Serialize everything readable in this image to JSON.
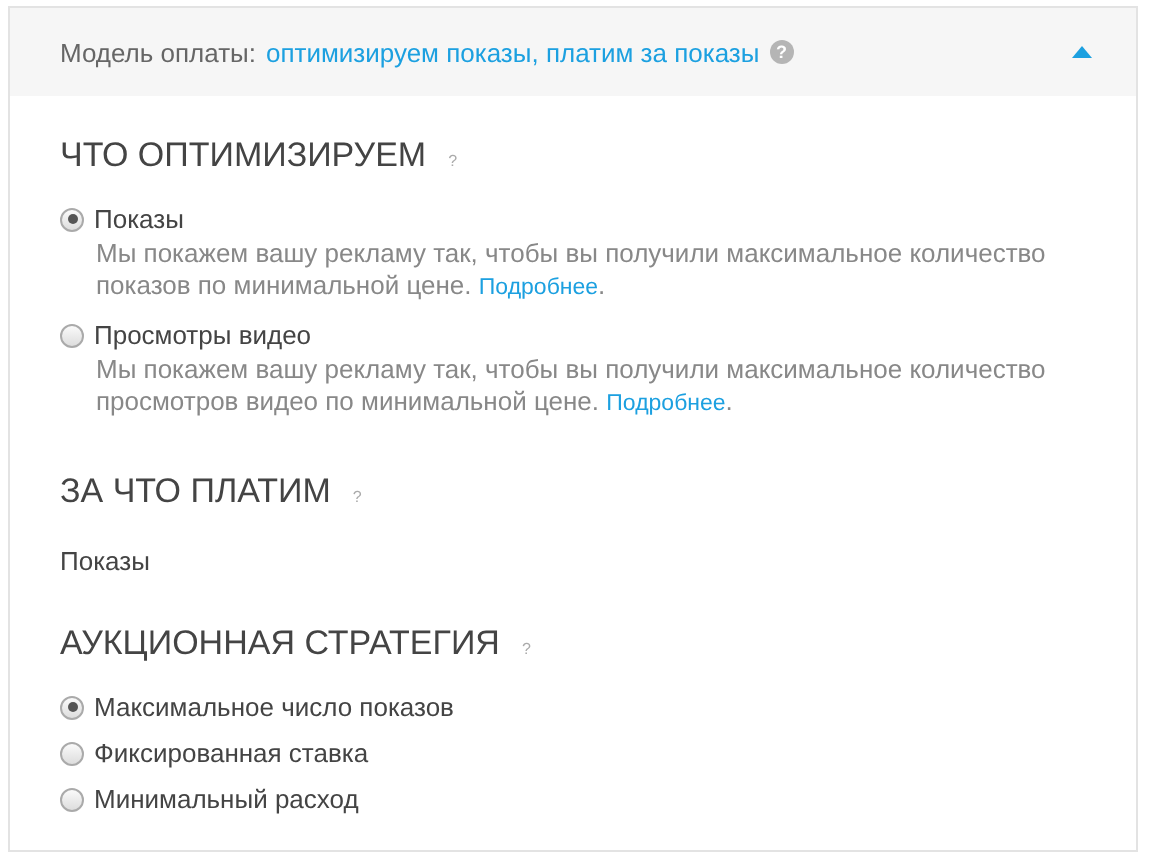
{
  "header": {
    "label": "Модель оплаты:",
    "value": "оптимизируем показы, платим за показы",
    "help": "?",
    "expanded": true
  },
  "sections": [
    {
      "kind": "radios",
      "title": "ЧТО ОПТИМИЗИРУЕМ",
      "help": "?",
      "options": [
        {
          "label": "Показы",
          "selected": true,
          "description": "Мы покажем вашу рекламу так, чтобы вы получили максимальное количество показов по минимальной цене.",
          "link": "Подробнее",
          "after": "."
        },
        {
          "label": "Просмотры видео",
          "selected": false,
          "description": "Мы покажем вашу рекламу так, чтобы вы получили максимальное количество просмотров видео по минимальной цене.",
          "link": "Подробнее",
          "after": "."
        }
      ]
    },
    {
      "kind": "value",
      "title": "ЗА ЧТО ПЛАТИМ",
      "help": "?",
      "value": "Показы"
    },
    {
      "kind": "radios",
      "title": "АУКЦИОННАЯ СТРАТЕГИЯ",
      "help": "?",
      "options": [
        {
          "label": "Максимальное число показов",
          "selected": true
        },
        {
          "label": "Фиксированная ставка",
          "selected": false
        },
        {
          "label": "Минимальный расход",
          "selected": false
        }
      ]
    }
  ]
}
